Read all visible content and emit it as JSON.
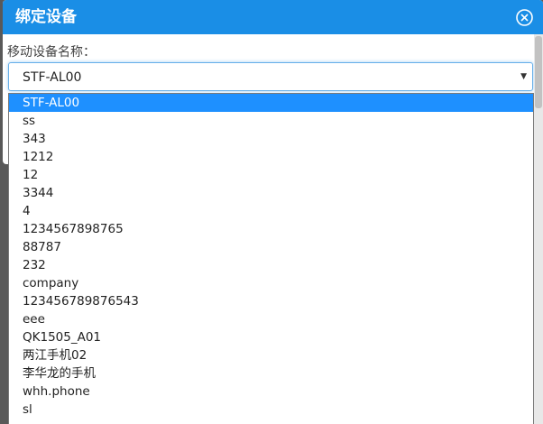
{
  "dialog": {
    "title": "绑定设备",
    "close_icon": "close-circle-icon",
    "accent_color": "#1a8ee6"
  },
  "form": {
    "device_label": "移动设备名称：",
    "selected_value": "STF-AL00"
  },
  "dropdown": {
    "options": [
      "STF-AL00",
      "ss",
      "343",
      "1212",
      "12",
      "3344",
      "4",
      "1234567898765",
      "88787",
      "232",
      "company",
      "123456789876543",
      "eee",
      "QK1505_A01",
      "两江手机02",
      "李华龙的手机",
      "whh.phone",
      "sl"
    ],
    "selected_index": 0
  }
}
